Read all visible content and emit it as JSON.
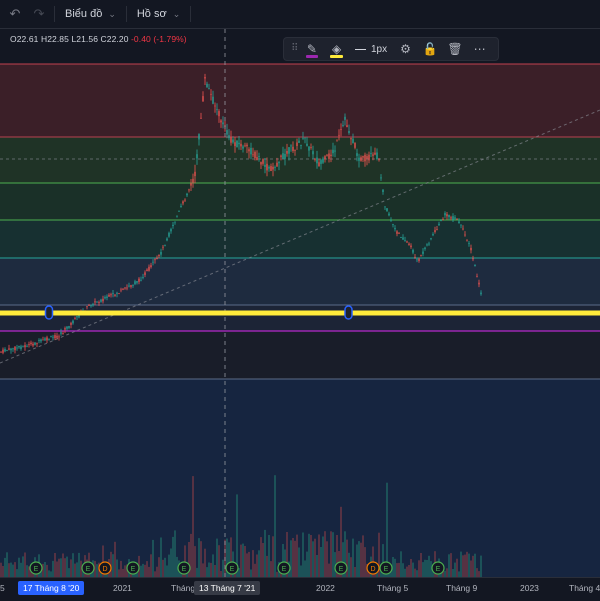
{
  "topbar": {
    "undo_icon": "undo-icon",
    "redo_icon": "redo-icon",
    "chart_menu_label": "Biểu đồ",
    "profile_menu_label": "Hồ sơ"
  },
  "ohlc": {
    "open": "O22.61",
    "high": "H22.85",
    "low": "L21.56",
    "close": "C22.20",
    "change": "-0.40 (-1.79%)",
    "change_color": "#f23645"
  },
  "drawing_toolbar": {
    "grip_icon": "drag-handle-icon",
    "pencil_icon": "pencil-icon",
    "pencil_color": "#9c27b0",
    "fill_icon": "fill-bucket-icon",
    "fill_color": "#ffeb3b",
    "line_width_label": "1px",
    "settings_icon": "gear-icon",
    "lock_icon": "lock-icon",
    "delete_icon": "trash-icon",
    "more_icon": "more-icon"
  },
  "xaxis": {
    "labels": [
      "5",
      "2021",
      "Tháng",
      "2022",
      "Tháng 5",
      "Tháng 9",
      "2023",
      "Tháng 4"
    ],
    "highlight_selected": "17 Tháng 8 '20",
    "highlight_crosshair": "13 Tháng 7 '21"
  },
  "event_markers": [
    "E",
    "E",
    "D",
    "E",
    "E",
    "E",
    "E",
    "E",
    "D",
    "E",
    "E"
  ],
  "colors": {
    "background": "#131722",
    "up_candle": "#26a69a",
    "down_candle": "#ef5350",
    "selected_line": "#ffeb3b",
    "level_purple": "#9c27b0",
    "x_highlight_blue": "#2962ff",
    "x_highlight_dark": "#363a45"
  }
}
